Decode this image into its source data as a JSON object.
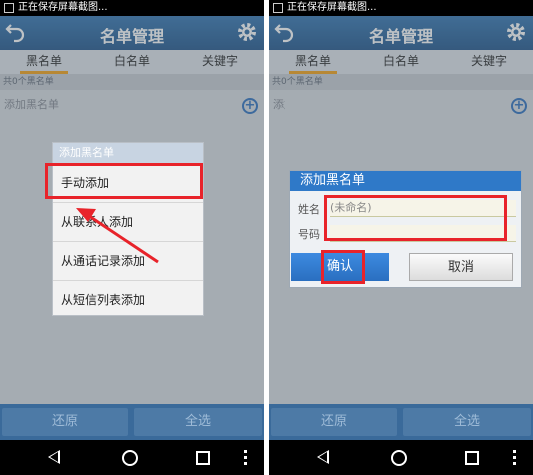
{
  "status": {
    "text": "正在保存屏幕截图..."
  },
  "header": {
    "title": "名单管理"
  },
  "tabs": [
    "黑名单",
    "白名单",
    "关键字"
  ],
  "list": {
    "count_text": "共0个黑名单",
    "add_text": "添加黑名单"
  },
  "menu": {
    "title": "添加黑名单",
    "items": [
      "手动添加",
      "从联系人添加",
      "从通话记录添加",
      "从短信列表添加"
    ]
  },
  "dialog": {
    "title": "添加黑名单",
    "name_label": "姓名",
    "name_placeholder": "(未命名)",
    "phone_label": "号码",
    "confirm_label": "确认",
    "cancel_label": "取消"
  },
  "bottom": {
    "restore_label": "还原",
    "select_all_label": "全选"
  },
  "colors": {
    "accent": "#2f79c8",
    "highlight": "#e8232a"
  }
}
